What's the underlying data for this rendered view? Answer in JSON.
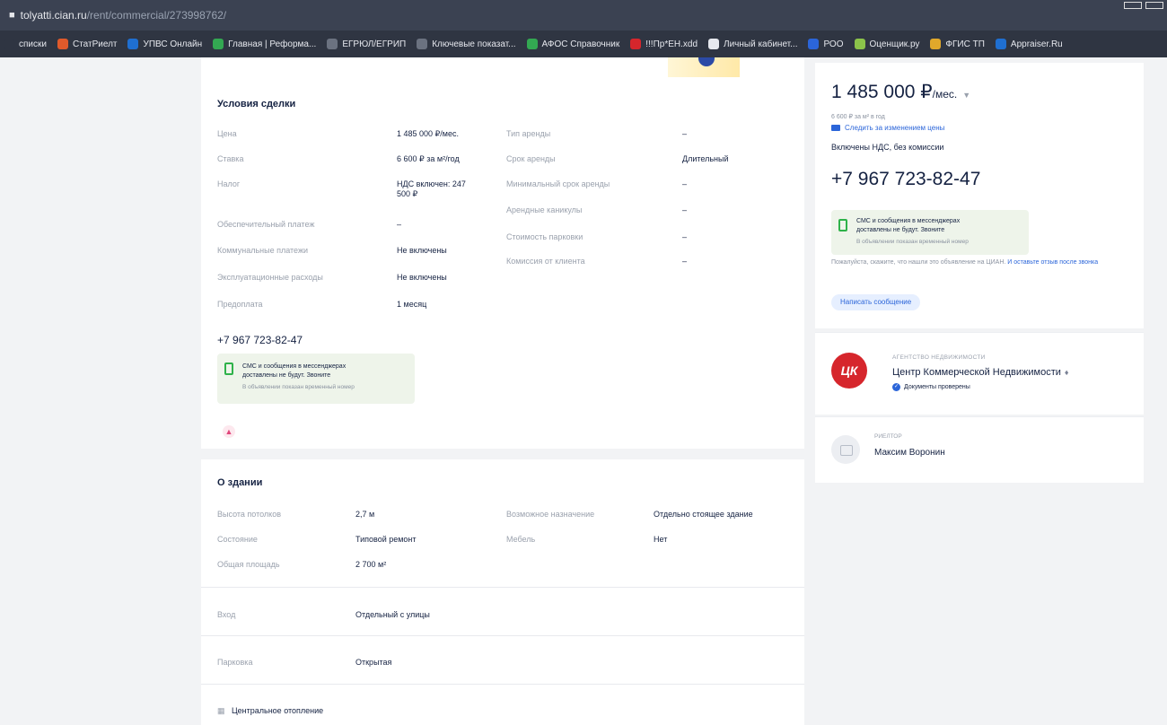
{
  "browser": {
    "url_host": "tolyatti.cian.ru",
    "url_path": "/rent/commercial/273998762/",
    "bookmarks": [
      {
        "label": "списки",
        "color": "#2f3542"
      },
      {
        "label": "СтатРиелт",
        "color": "#e05a2b"
      },
      {
        "label": "УПВС Онлайн",
        "color": "#1f6fd1"
      },
      {
        "label": "Главная | Реформа...",
        "color": "#33a852"
      },
      {
        "label": "ЕГРЮЛ/ЕГРИП",
        "color": "#6b7280"
      },
      {
        "label": "Ключевые показат...",
        "color": "#6b7280"
      },
      {
        "label": "АФОС Справочник",
        "color": "#33a852"
      },
      {
        "label": "!!!Пр*ЕН.xdd",
        "color": "#d6262c"
      },
      {
        "label": "Личный кабинет...",
        "color": "#e6e8ee"
      },
      {
        "label": "РОО",
        "color": "#2b65d9"
      },
      {
        "label": "Оценщик.ру",
        "color": "#8bc34a"
      },
      {
        "label": "ФГИС ТП",
        "color": "#e0a82b"
      },
      {
        "label": "Appraiser.Ru",
        "color": "#1f6fd1"
      }
    ]
  },
  "deal": {
    "title": "Условия сделки",
    "left_rows": [
      {
        "label": "Цена",
        "value": "1 485 000 ₽/мес."
      },
      {
        "label": "Ставка",
        "value": "6 600 ₽ за м²/год"
      },
      {
        "label": "Налог",
        "value": "НДС включен: 247 500 ₽"
      },
      {
        "label": "Обеспечительный платеж",
        "value": "–"
      },
      {
        "label": "Коммунальные платежи",
        "value": "Не включены"
      },
      {
        "label": "Эксплуатационные расходы",
        "value": "Не включены"
      },
      {
        "label": "Предоплата",
        "value": "1 месяц"
      }
    ],
    "right_rows": [
      {
        "label": "Тип аренды",
        "value": "–"
      },
      {
        "label": "Срок аренды",
        "value": "Длительный"
      },
      {
        "label": "Минимальный срок аренды",
        "value": "–"
      },
      {
        "label": "Арендные каникулы",
        "value": "–"
      },
      {
        "label": "Стоимость парковки",
        "value": "–"
      },
      {
        "label": "Комиссия от клиента",
        "value": "–"
      }
    ],
    "phone": "+7 967 723-82-47",
    "sms_line1": "СМС и сообщения в мессенджерах",
    "sms_line2": "доставлены не будут. Звоните",
    "sms_line3": "В объявлении показан временный номер"
  },
  "building": {
    "title": "О здании",
    "left_rows": [
      {
        "label": "Высота потолков",
        "value": "2,7 м"
      },
      {
        "label": "Состояние",
        "value": "Типовой ремонт"
      },
      {
        "label": "Общая площадь",
        "value": "2 700 м²"
      }
    ],
    "right_rows": [
      {
        "label": "Возможное назначение",
        "value": "Отдельно стоящее здание"
      },
      {
        "label": "Мебель",
        "value": "Нет"
      }
    ],
    "entrance_label": "Вход",
    "entrance_value": "Отдельный с улицы",
    "parking_label": "Парковка",
    "parking_value": "Открытая",
    "heating": "Центральное отопление"
  },
  "sidebar": {
    "price": "1 485 000 ₽",
    "price_unit": "/мес.",
    "price_sub": "6 600 ₽ за м² в год",
    "track_price": "Следить за изменением цены",
    "vat": "Включены НДС, без комиссии",
    "phone": "+7 967 723-82-47",
    "sms_line1": "СМС и сообщения в мессенджерах",
    "sms_line2": "доставлены не будут. Звоните",
    "sms_line3": "В объявлении показан временный номер",
    "notice_text": "Пожалуйста, скажите, что нашли это объявление на ЦИАН.",
    "notice_link": "И оставьте отзыв после звонка",
    "write_message": "Написать сообщение",
    "agency_type": "АГЕНТСТВО НЕДВИЖИМОСТИ",
    "agency_name": "Центр Коммерческой Недвижимости",
    "agency_verified": "Документы проверены",
    "realtor_type": "РИЕЛТОР",
    "realtor_name": "Максим Воронин"
  }
}
